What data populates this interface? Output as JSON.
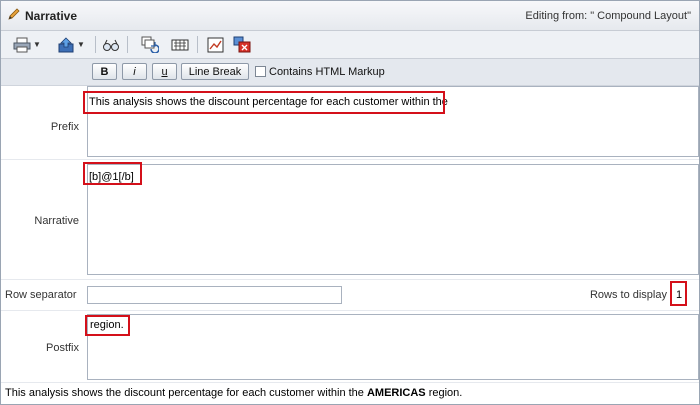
{
  "header": {
    "title": "Narrative",
    "editing_from": "Editing from: \" Compound Layout\""
  },
  "toolbar": {
    "icons": [
      "print-icon",
      "export-icon",
      "preview-icon",
      "refresh-icon",
      "properties-icon",
      "edit-chart-icon",
      "delete-view-icon"
    ]
  },
  "format": {
    "bold_label": "B",
    "italic_label": "i",
    "underline_label": "u",
    "line_break_label": "Line Break",
    "html_markup_label": "Contains HTML Markup",
    "html_markup_checked": false
  },
  "form": {
    "prefix_label": "Prefix",
    "prefix_value": "This analysis shows the discount percentage for each customer within the",
    "narrative_label": "Narrative",
    "narrative_value": "[b]@1[/b]",
    "row_separator_label": "Row separator",
    "row_separator_value": "",
    "rows_to_display_label": "Rows to display",
    "rows_to_display_value": "1",
    "postfix_label": "Postfix",
    "postfix_value": "region."
  },
  "preview": {
    "text_before": "This analysis shows the discount percentage for each customer within the ",
    "text_bold": "AMERICAS",
    "text_after": " region."
  },
  "colors": {
    "highlight": "#d4101a",
    "toolbar_bg": "#eef1f5"
  }
}
